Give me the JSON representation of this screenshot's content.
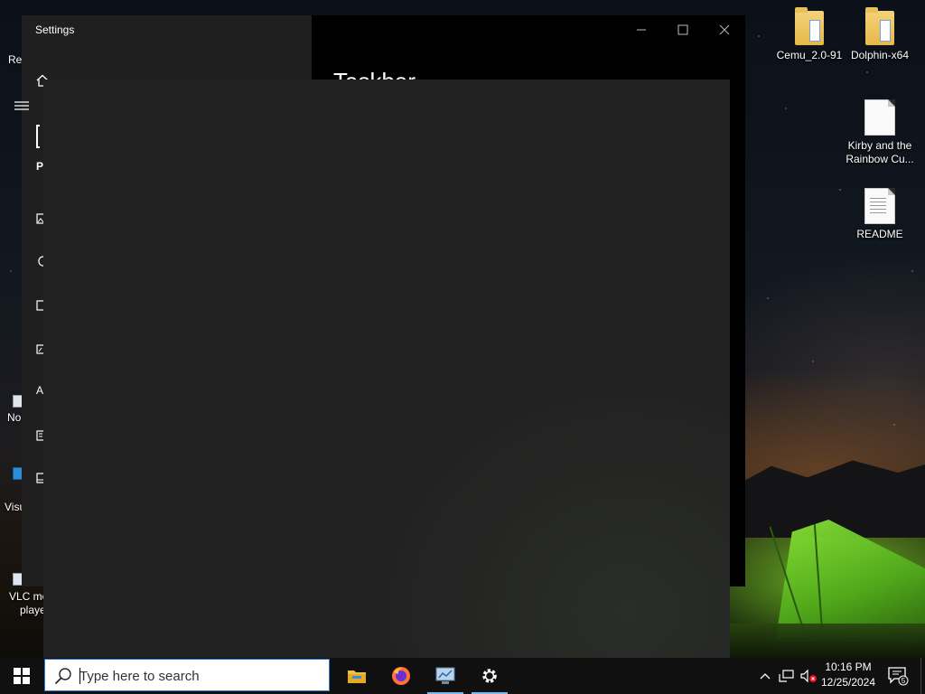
{
  "desktop": {
    "icons": [
      {
        "label": "Cemu_2.0-91",
        "type": "folder"
      },
      {
        "label": "Dolphin-x64",
        "type": "folder"
      },
      {
        "label": "Kirby and the Rainbow Cu...",
        "type": "document"
      },
      {
        "label": "README",
        "type": "text-document"
      }
    ],
    "left_edge_labels": {
      "recycle": "Re",
      "notepad": "No",
      "vscode": "Visu",
      "vlc_line1": "VLC me",
      "vlc_line2": "playe"
    }
  },
  "settings_window": {
    "title": "Settings",
    "heading": "Taskbar",
    "sidebar_glyph_p": "P",
    "sidebar_glyph_a": "A",
    "controls": {
      "minimize": "—",
      "maximize": "☐",
      "close": "✕"
    }
  },
  "taskbar": {
    "search_placeholder": "Type here to search",
    "apps": [
      {
        "name": "file-explorer",
        "active": false
      },
      {
        "name": "firefox",
        "active": false
      },
      {
        "name": "control-panel",
        "active": true
      },
      {
        "name": "settings",
        "active": true
      }
    ],
    "clock_time": "10:16 PM",
    "clock_date": "12/25/2024",
    "notification_count": "5",
    "accent": "#76b9ed"
  }
}
